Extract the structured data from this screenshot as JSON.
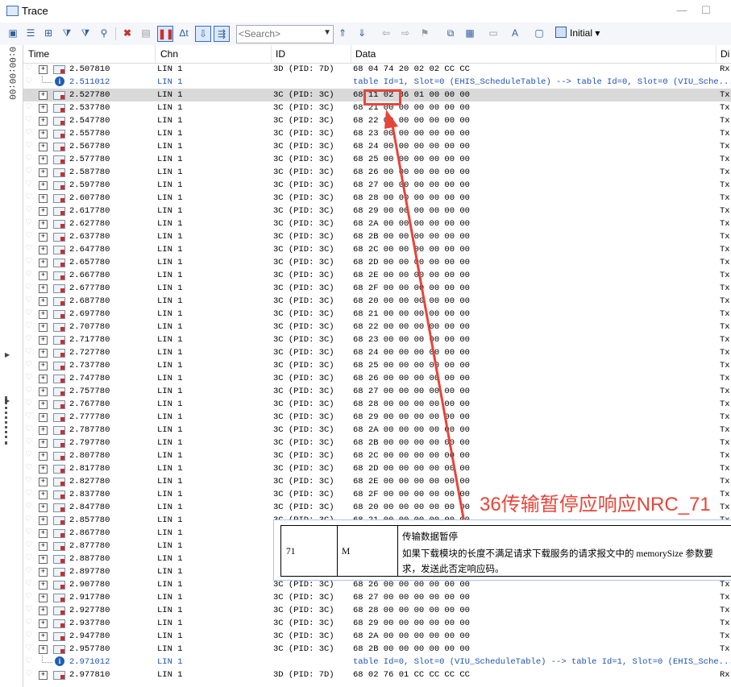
{
  "window": {
    "title": "Trace",
    "minimize": "—",
    "maximize": "☐"
  },
  "toolbar": {
    "search_placeholder": "<Search>",
    "initial_label": "Initial"
  },
  "side_time": "0:00:00:00",
  "columns": {
    "time": "Time",
    "chn": "Chn",
    "id": "ID",
    "data": "Data",
    "dir": "Di"
  },
  "rows": [
    {
      "kind": "msg",
      "time": "2.507810",
      "chn": "LIN 1",
      "id": "3D (PID: 7D)",
      "data": "68 04 74 20 02 02 CC CC",
      "dir": "Rx"
    },
    {
      "kind": "info",
      "time": "2.511012",
      "chn": "LIN 1",
      "id": "",
      "data": "table Id=1, Slot=0 (EHIS_ScheduleTable) --> table Id=0, Slot=0 (VIU_Sche...",
      "dir": ""
    },
    {
      "kind": "msg",
      "time": "2.527780",
      "chn": "LIN 1",
      "id": "3C (PID: 3C)",
      "data": "68 11 02 36 01 00 00 00",
      "dir": "Tx",
      "selected": true
    },
    {
      "kind": "msg",
      "time": "2.537780",
      "chn": "LIN 1",
      "id": "3C (PID: 3C)",
      "data": "68 21 00 00 00 00 00 00",
      "dir": "Tx"
    },
    {
      "kind": "msg",
      "time": "2.547780",
      "chn": "LIN 1",
      "id": "3C (PID: 3C)",
      "data": "68 22 00 00 00 00 00 00",
      "dir": "Tx"
    },
    {
      "kind": "msg",
      "time": "2.557780",
      "chn": "LIN 1",
      "id": "3C (PID: 3C)",
      "data": "68 23 00 00 00 00 00 00",
      "dir": "Tx"
    },
    {
      "kind": "msg",
      "time": "2.567780",
      "chn": "LIN 1",
      "id": "3C (PID: 3C)",
      "data": "68 24 00 00 00 00 00 00",
      "dir": "Tx"
    },
    {
      "kind": "msg",
      "time": "2.577780",
      "chn": "LIN 1",
      "id": "3C (PID: 3C)",
      "data": "68 25 00 00 00 00 00 00",
      "dir": "Tx"
    },
    {
      "kind": "msg",
      "time": "2.587780",
      "chn": "LIN 1",
      "id": "3C (PID: 3C)",
      "data": "68 26 00 00 00 00 00 00",
      "dir": "Tx"
    },
    {
      "kind": "msg",
      "time": "2.597780",
      "chn": "LIN 1",
      "id": "3C (PID: 3C)",
      "data": "68 27 00 00 00 00 00 00",
      "dir": "Tx"
    },
    {
      "kind": "msg",
      "time": "2.607780",
      "chn": "LIN 1",
      "id": "3C (PID: 3C)",
      "data": "68 28 00 00 00 00 00 00",
      "dir": "Tx"
    },
    {
      "kind": "msg",
      "time": "2.617780",
      "chn": "LIN 1",
      "id": "3C (PID: 3C)",
      "data": "68 29 00 00 00 00 00 00",
      "dir": "Tx"
    },
    {
      "kind": "msg",
      "time": "2.627780",
      "chn": "LIN 1",
      "id": "3C (PID: 3C)",
      "data": "68 2A 00 00 00 00 00 00",
      "dir": "Tx"
    },
    {
      "kind": "msg",
      "time": "2.637780",
      "chn": "LIN 1",
      "id": "3C (PID: 3C)",
      "data": "68 2B 00 00 00 00 00 00",
      "dir": "Tx"
    },
    {
      "kind": "msg",
      "time": "2.647780",
      "chn": "LIN 1",
      "id": "3C (PID: 3C)",
      "data": "68 2C 00 00 00 00 00 00",
      "dir": "Tx"
    },
    {
      "kind": "msg",
      "time": "2.657780",
      "chn": "LIN 1",
      "id": "3C (PID: 3C)",
      "data": "68 2D 00 00 00 00 00 00",
      "dir": "Tx"
    },
    {
      "kind": "msg",
      "time": "2.667780",
      "chn": "LIN 1",
      "id": "3C (PID: 3C)",
      "data": "68 2E 00 00 00 00 00 00",
      "dir": "Tx"
    },
    {
      "kind": "msg",
      "time": "2.677780",
      "chn": "LIN 1",
      "id": "3C (PID: 3C)",
      "data": "68 2F 00 00 00 00 00 00",
      "dir": "Tx"
    },
    {
      "kind": "msg",
      "time": "2.687780",
      "chn": "LIN 1",
      "id": "3C (PID: 3C)",
      "data": "68 20 00 00 00 00 00 00",
      "dir": "Tx"
    },
    {
      "kind": "msg",
      "time": "2.697780",
      "chn": "LIN 1",
      "id": "3C (PID: 3C)",
      "data": "68 21 00 00 00 00 00 00",
      "dir": "Tx"
    },
    {
      "kind": "msg",
      "time": "2.707780",
      "chn": "LIN 1",
      "id": "3C (PID: 3C)",
      "data": "68 22 00 00 00 00 00 00",
      "dir": "Tx"
    },
    {
      "kind": "msg",
      "time": "2.717780",
      "chn": "LIN 1",
      "id": "3C (PID: 3C)",
      "data": "68 23 00 00 00 00 00 00",
      "dir": "Tx"
    },
    {
      "kind": "msg",
      "time": "2.727780",
      "chn": "LIN 1",
      "id": "3C (PID: 3C)",
      "data": "68 24 00 00 00 00 00 00",
      "dir": "Tx"
    },
    {
      "kind": "msg",
      "time": "2.737780",
      "chn": "LIN 1",
      "id": "3C (PID: 3C)",
      "data": "68 25 00 00 00 00 00 00",
      "dir": "Tx"
    },
    {
      "kind": "msg",
      "time": "2.747780",
      "chn": "LIN 1",
      "id": "3C (PID: 3C)",
      "data": "68 26 00 00 00 00 00 00",
      "dir": "Tx"
    },
    {
      "kind": "msg",
      "time": "2.757780",
      "chn": "LIN 1",
      "id": "3C (PID: 3C)",
      "data": "68 27 00 00 00 00 00 00",
      "dir": "Tx"
    },
    {
      "kind": "msg",
      "time": "2.767780",
      "chn": "LIN 1",
      "id": "3C (PID: 3C)",
      "data": "68 28 00 00 00 00 00 00",
      "dir": "Tx"
    },
    {
      "kind": "msg",
      "time": "2.777780",
      "chn": "LIN 1",
      "id": "3C (PID: 3C)",
      "data": "68 29 00 00 00 00 00 00",
      "dir": "Tx"
    },
    {
      "kind": "msg",
      "time": "2.787780",
      "chn": "LIN 1",
      "id": "3C (PID: 3C)",
      "data": "68 2A 00 00 00 00 00 00",
      "dir": "Tx"
    },
    {
      "kind": "msg",
      "time": "2.797780",
      "chn": "LIN 1",
      "id": "3C (PID: 3C)",
      "data": "68 2B 00 00 00 00 00 00",
      "dir": "Tx"
    },
    {
      "kind": "msg",
      "time": "2.807780",
      "chn": "LIN 1",
      "id": "3C (PID: 3C)",
      "data": "68 2C 00 00 00 00 00 00",
      "dir": "Tx"
    },
    {
      "kind": "msg",
      "time": "2.817780",
      "chn": "LIN 1",
      "id": "3C (PID: 3C)",
      "data": "68 2D 00 00 00 00 00 00",
      "dir": "Tx"
    },
    {
      "kind": "msg",
      "time": "2.827780",
      "chn": "LIN 1",
      "id": "3C (PID: 3C)",
      "data": "68 2E 00 00 00 00 00 00",
      "dir": "Tx"
    },
    {
      "kind": "msg",
      "time": "2.837780",
      "chn": "LIN 1",
      "id": "3C (PID: 3C)",
      "data": "68 2F 00 00 00 00 00 00",
      "dir": "Tx"
    },
    {
      "kind": "msg",
      "time": "2.847780",
      "chn": "LIN 1",
      "id": "3C (PID: 3C)",
      "data": "68 20 00 00 00 00 00 00",
      "dir": "Tx"
    },
    {
      "kind": "msg",
      "time": "2.857780",
      "chn": "LIN 1",
      "id": "3C (PID: 3C)",
      "data": "68 21 00 00 00 00 00 00",
      "dir": "Tx"
    },
    {
      "kind": "msg",
      "time": "2.867780",
      "chn": "LIN 1",
      "id": "",
      "data": "",
      "dir": "Tx"
    },
    {
      "kind": "msg",
      "time": "2.877780",
      "chn": "LIN 1",
      "id": "",
      "data": "",
      "dir": "Tx"
    },
    {
      "kind": "msg",
      "time": "2.887780",
      "chn": "LIN 1",
      "id": "",
      "data": "",
      "dir": "Tx"
    },
    {
      "kind": "msg",
      "time": "2.897780",
      "chn": "LIN 1",
      "id": "",
      "data": "",
      "dir": "Tx"
    },
    {
      "kind": "msg",
      "time": "2.907780",
      "chn": "LIN 1",
      "id": "3C (PID: 3C)",
      "data": "68 26 00 00 00 00 00 00",
      "dir": "Tx"
    },
    {
      "kind": "msg",
      "time": "2.917780",
      "chn": "LIN 1",
      "id": "3C (PID: 3C)",
      "data": "68 27 00 00 00 00 00 00",
      "dir": "Tx"
    },
    {
      "kind": "msg",
      "time": "2.927780",
      "chn": "LIN 1",
      "id": "3C (PID: 3C)",
      "data": "68 28 00 00 00 00 00 00",
      "dir": "Tx"
    },
    {
      "kind": "msg",
      "time": "2.937780",
      "chn": "LIN 1",
      "id": "3C (PID: 3C)",
      "data": "68 29 00 00 00 00 00 00",
      "dir": "Tx"
    },
    {
      "kind": "msg",
      "time": "2.947780",
      "chn": "LIN 1",
      "id": "3C (PID: 3C)",
      "data": "68 2A 00 00 00 00 00 00",
      "dir": "Tx"
    },
    {
      "kind": "msg",
      "time": "2.957780",
      "chn": "LIN 1",
      "id": "3C (PID: 3C)",
      "data": "68 2B 00 00 00 00 00 00",
      "dir": "Tx"
    },
    {
      "kind": "info",
      "time": "2.971012",
      "chn": "LIN 1",
      "id": "",
      "data": "table Id=0, Slot=0 (VIU_ScheduleTable) --> table Id=1, Slot=0 (EHIS_Sche...",
      "dir": ""
    },
    {
      "kind": "msg",
      "time": "2.977810",
      "chn": "LIN 1",
      "id": "3D (PID: 7D)",
      "data": "68 02 76 01 CC CC CC CC",
      "dir": "Rx"
    }
  ],
  "annotation": {
    "text": "36传输暂停应响应NRC_71",
    "color": "#e8453a"
  },
  "tooltip": {
    "nrc": "71",
    "level": "M",
    "title": "传输数据暂停",
    "description": "如果下载模块的长度不满足请求下载服务的请求报文中的 memorySize 参数要求，发送此否定响应码。"
  },
  "colors": {
    "selected_row": "#d9d9d9",
    "info_text": "#1d4fb3",
    "highlight": "#e8453a"
  }
}
